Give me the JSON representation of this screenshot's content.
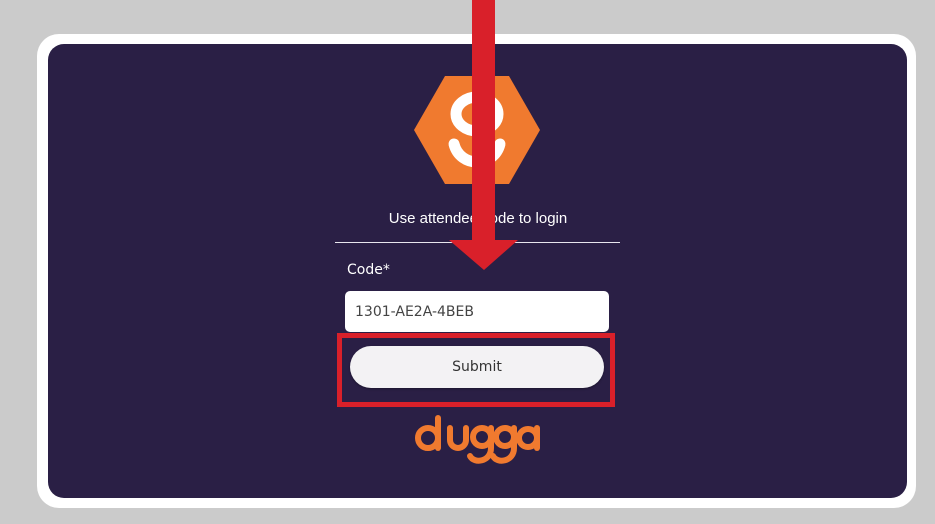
{
  "colors": {
    "page_background": "#cbcbcb",
    "card_background": "#2a1f45",
    "brand_orange": "#f07a2f",
    "annotation_red": "#d9202a"
  },
  "login": {
    "prompt": "Use attendee code to login",
    "code_label": "Code*",
    "code_value": "1301-AE2A-4BEB",
    "submit_label": "Submit"
  },
  "brand": {
    "logo_icon": "hexagon-s-logo-icon",
    "wordmark": "dugga"
  },
  "annotations": {
    "arrow_icon": "arrow-down-icon",
    "highlight": "submit-highlight-box"
  }
}
